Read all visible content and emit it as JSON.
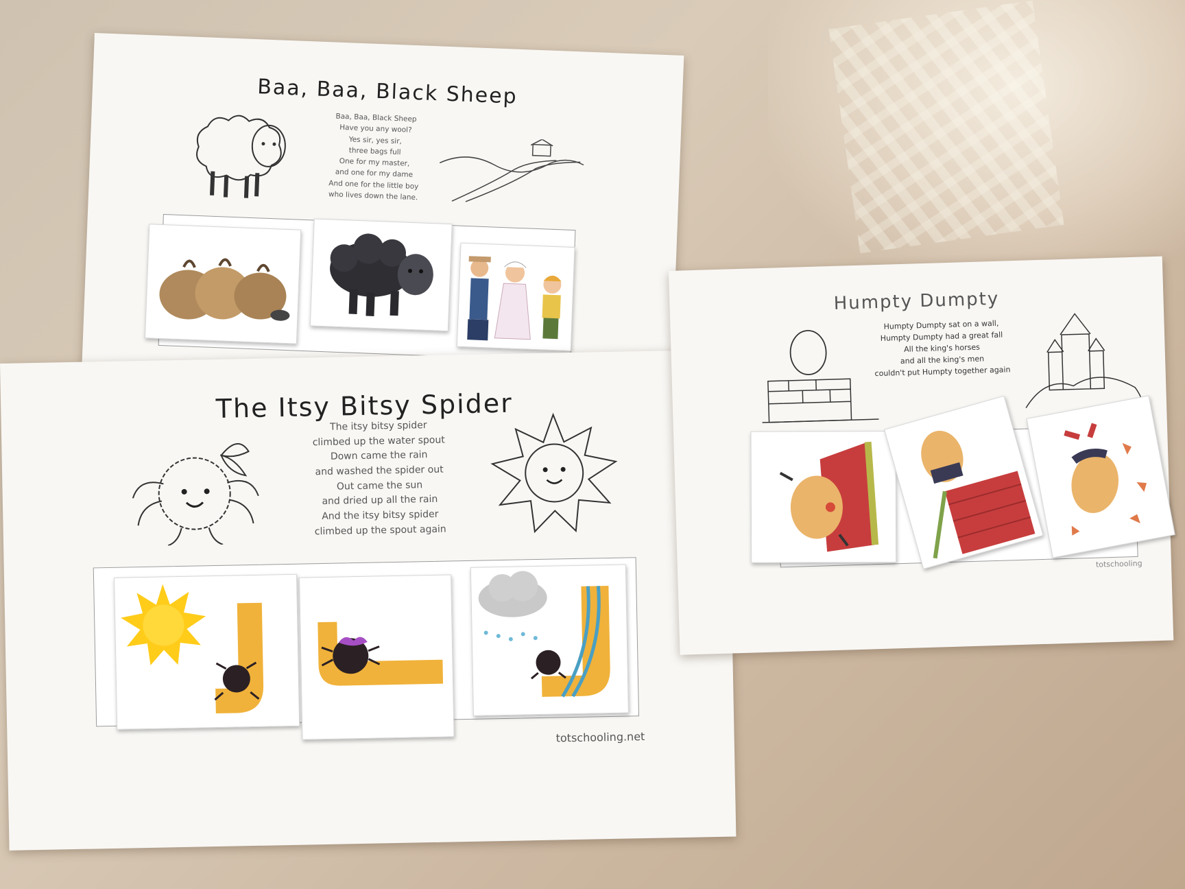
{
  "colors": {
    "table": "#d4c5b2",
    "paper": "#f8f7f4",
    "ink": "#222222",
    "spout": "#f0b23a",
    "sun": "#ffcc1a",
    "brick": "#c73d3d"
  },
  "sheets": {
    "sheep": {
      "title": "Baa, Baa, Black Sheep",
      "poem": [
        "Baa, Baa, Black Sheep",
        "Have you any wool?",
        "Yes sir, yes sir,",
        "three bags full",
        "One for my master,",
        "and one for my dame",
        "And one for the little boy",
        "who lives down the lane."
      ]
    },
    "spider": {
      "title": "The Itsy Bitsy Spider",
      "poem": [
        "The itsy bitsy spider",
        "climbed up the water spout",
        "Down came the rain",
        "and washed the spider out",
        "Out came the sun",
        "and dried up all the rain",
        "And the itsy bitsy spider",
        "climbed up the spout again"
      ],
      "brand": "totschooling.net"
    },
    "humpty": {
      "title": "Humpty Dumpty",
      "poem": [
        "Humpty Dumpty sat on a wall,",
        "Humpty Dumpty had a great fall",
        "All the king's horses",
        "and all the king's men",
        "couldn't put Humpty together again"
      ],
      "brand": "totschooling"
    }
  }
}
